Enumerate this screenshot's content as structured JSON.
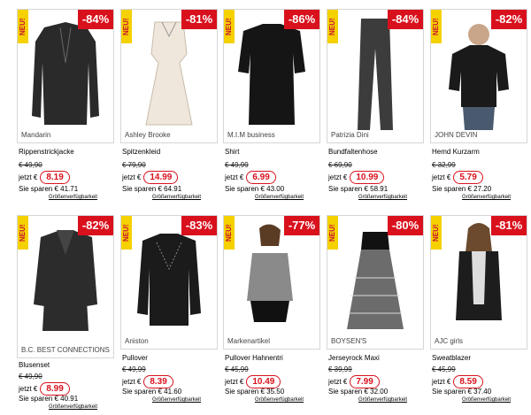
{
  "badge_new": "NEU!",
  "products": [
    {
      "discount": "-84%",
      "brand": "Mandarin",
      "name": "Rippenstrickjacke",
      "old_price": "€ 49,90",
      "now_label": "jetzt €",
      "price": "8.19",
      "save": "Sie sparen € 41.71",
      "size_link": "Größenverfügbarkeit"
    },
    {
      "discount": "-81%",
      "brand": "Ashley Brooke",
      "name": "Spitzenkleid",
      "old_price": "€ 79,90",
      "now_label": "jetzt €",
      "price": "14.99",
      "save": "Sie sparen € 64.91",
      "size_link": "Größenverfügbarkeit"
    },
    {
      "discount": "-86%",
      "brand": "M.I.M business",
      "name": "Shirt",
      "old_price": "€ 49,99",
      "now_label": "jetzt €",
      "price": "6.99",
      "save": "Sie sparen € 43.00",
      "size_link": "Größenverfügbarkeit"
    },
    {
      "discount": "-84%",
      "brand": "Patrizia Dini",
      "name": "Bundfaltenhose",
      "old_price": "€ 69,90",
      "now_label": "jetzt €",
      "price": "10.99",
      "save": "Sie sparen € 58.91",
      "size_link": "Größenverfügbarkeit"
    },
    {
      "discount": "-82%",
      "brand": "JOHN DEVIN",
      "name": "Hemd Kurzarm",
      "old_price": "€ 32,99",
      "now_label": "jetzt €",
      "price": "5.79",
      "save": "Sie sparen € 27.20",
      "size_link": "Größenverfügbarkeit"
    },
    {
      "discount": "-82%",
      "brand": "B.C. BEST CONNECTIONS",
      "name": "Blusenset",
      "old_price": "€ 49,90",
      "now_label": "jetzt €",
      "price": "8.99",
      "save": "Sie sparen € 40.91",
      "size_link": "Größenverfügbarkeit"
    },
    {
      "discount": "-83%",
      "brand": "Aniston",
      "name": "Pullover",
      "old_price": "€ 49,99",
      "now_label": "jetzt €",
      "price": "8.39",
      "save": "Sie sparen € 41.60",
      "size_link": "Größenverfügbarkeit"
    },
    {
      "discount": "-77%",
      "brand": "Markenartikel",
      "name": "Pullover Hahnentri",
      "old_price": "€ 45,99",
      "now_label": "jetzt €",
      "price": "10.49",
      "save": "Sie sparen € 35.50",
      "size_link": "Größenverfügbarkeit"
    },
    {
      "discount": "-80%",
      "brand": "BOYSEN'S",
      "name": "Jerseyrock Maxi",
      "old_price": "€ 39,99",
      "now_label": "jetzt €",
      "price": "7.99",
      "save": "Sie sparen € 32.00",
      "size_link": "Größenverfügbarkeit"
    },
    {
      "discount": "-81%",
      "brand": "AJC girls",
      "name": "Sweatblazer",
      "old_price": "€ 45,99",
      "now_label": "jetzt €",
      "price": "8.59",
      "save": "Sie sparen € 37.40",
      "size_link": "Größenverfügbarkeit"
    }
  ]
}
